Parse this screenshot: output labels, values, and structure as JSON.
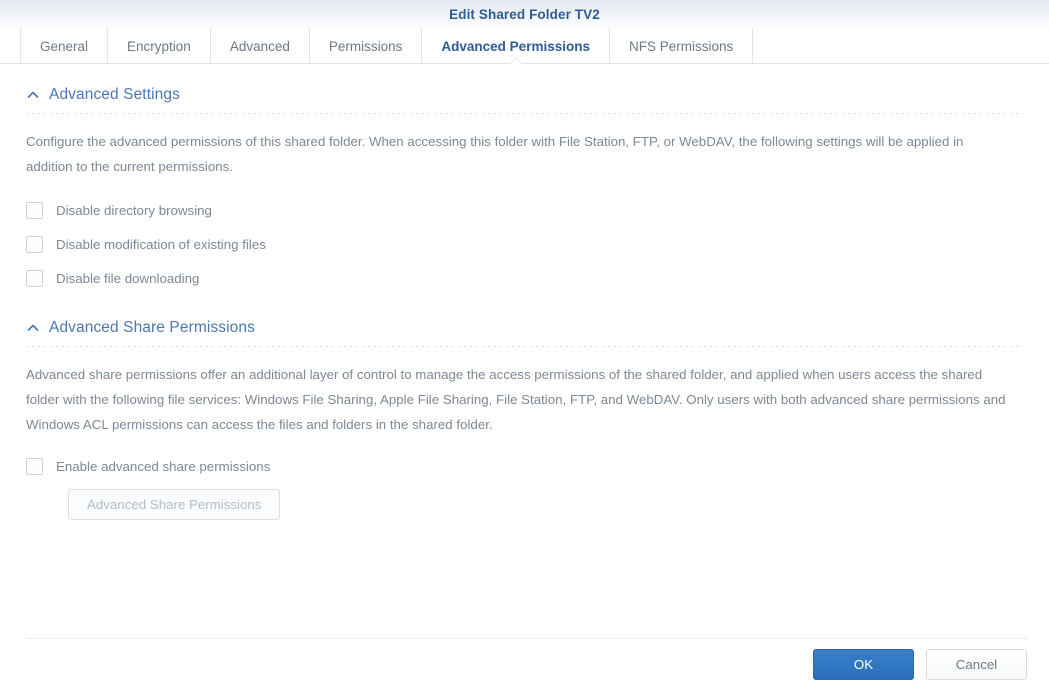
{
  "window": {
    "title": "Edit Shared Folder TV2"
  },
  "tabs": [
    {
      "label": "General",
      "active": false
    },
    {
      "label": "Encryption",
      "active": false
    },
    {
      "label": "Advanced",
      "active": false
    },
    {
      "label": "Permissions",
      "active": false
    },
    {
      "label": "Advanced Permissions",
      "active": true
    },
    {
      "label": "NFS Permissions",
      "active": false
    }
  ],
  "sections": {
    "advanced_settings": {
      "title": "Advanced Settings",
      "chevron_icon": "chevron-up-icon",
      "description": "Configure the advanced permissions of this shared folder. When accessing this folder with File Station, FTP, or WebDAV, the following settings will be applied in addition to the current permissions.",
      "checkboxes": [
        {
          "label": "Disable directory browsing",
          "checked": false
        },
        {
          "label": "Disable modification of existing files",
          "checked": false
        },
        {
          "label": "Disable file downloading",
          "checked": false
        }
      ]
    },
    "advanced_share_permissions": {
      "title": "Advanced Share Permissions",
      "chevron_icon": "chevron-up-icon",
      "description": "Advanced share permissions offer an additional layer of control to manage the access permissions of the shared folder, and applied when users access the shared folder with the following file services: Windows File Sharing, Apple File Sharing, File Station, FTP, and WebDAV. Only users with both advanced share permissions and Windows ACL permissions can access the files and folders in the shared folder.",
      "enable_checkbox": {
        "label": "Enable advanced share permissions",
        "checked": false
      },
      "button": {
        "label": "Advanced Share Permissions",
        "disabled": true
      }
    }
  },
  "footer": {
    "ok_label": "OK",
    "cancel_label": "Cancel"
  },
  "colors": {
    "title_blue": "#2f5c96",
    "section_blue": "#4a78b5",
    "body_text": "#7c8896",
    "primary_button": "#2a6fba"
  }
}
